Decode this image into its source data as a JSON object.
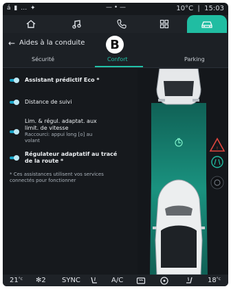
{
  "status_bar": {
    "left_icons": "á ▮ … ✦",
    "center": "— • —",
    "temperature": "10°C",
    "time": "15:03"
  },
  "nav_tabs": [
    {
      "icon": "home-icon"
    },
    {
      "icon": "music-icon"
    },
    {
      "icon": "phone-icon"
    },
    {
      "icon": "apps-icon"
    },
    {
      "icon": "car-icon",
      "active": true
    }
  ],
  "header": {
    "back_icon": "←",
    "title": "Aides à la conduite",
    "badge": "B"
  },
  "tabs": [
    {
      "label": "Sécurité"
    },
    {
      "label": "Confort",
      "active": true
    },
    {
      "label": "Parking"
    }
  ],
  "settings": [
    {
      "label": "Assistant prédictif Eco *",
      "enabled": true
    },
    {
      "label": "Distance de suivi",
      "enabled": true
    },
    {
      "label_line1": "Lim. & régul. adaptat. aux",
      "label_line2": "limit. de vitesse",
      "sub_line1": "Raccourci: appui long [o] au",
      "sub_line2": "volant",
      "enabled": true
    },
    {
      "label_line1": "Régulateur adaptatif au tracé",
      "label_line2": "de la route *",
      "enabled": true
    }
  ],
  "footnote": {
    "line1": "* Ces assistances utilisent vos services",
    "line2": "connectés pour fonctionner"
  },
  "climate_bar": {
    "left_temp": "21",
    "left_unit": "°c",
    "fan_level": "2",
    "sync": "SYNC",
    "ac": "A/C",
    "right_temp": "18",
    "right_unit": "°c"
  },
  "colors": {
    "accent": "#20bda2",
    "toggle_on": "#1aa5c9",
    "lane": "#1b9c86",
    "background": "#16191d"
  }
}
